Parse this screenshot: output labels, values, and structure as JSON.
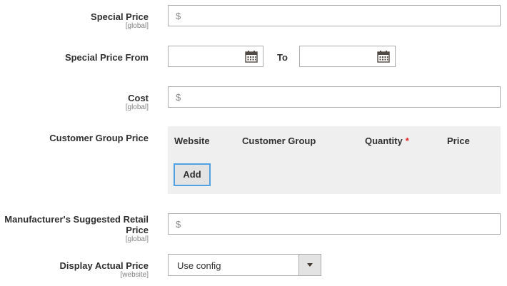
{
  "special_price": {
    "label": "Special Price",
    "scope": "[global]",
    "currency": "$",
    "value": ""
  },
  "special_price_from": {
    "label": "Special Price From",
    "to_label": "To",
    "from_value": "",
    "to_value": ""
  },
  "cost": {
    "label": "Cost",
    "scope": "[global]",
    "currency": "$",
    "value": ""
  },
  "customer_group_price": {
    "label": "Customer Group Price",
    "columns": [
      "Website",
      "Customer Group",
      "Quantity",
      "Price"
    ],
    "required_marker": "*",
    "add_label": "Add"
  },
  "msrp": {
    "label_line1": "Manufacturer's Suggested Retail",
    "label_line2": "Price",
    "scope": "[global]",
    "currency": "$",
    "value": ""
  },
  "display_actual_price": {
    "label": "Display Actual Price",
    "scope": "[website]",
    "selected": "Use config"
  },
  "colors": {
    "accent_focus": "#52a1e3",
    "required": "#e22626",
    "panel_bg": "#efefef",
    "border": "#adadad"
  }
}
